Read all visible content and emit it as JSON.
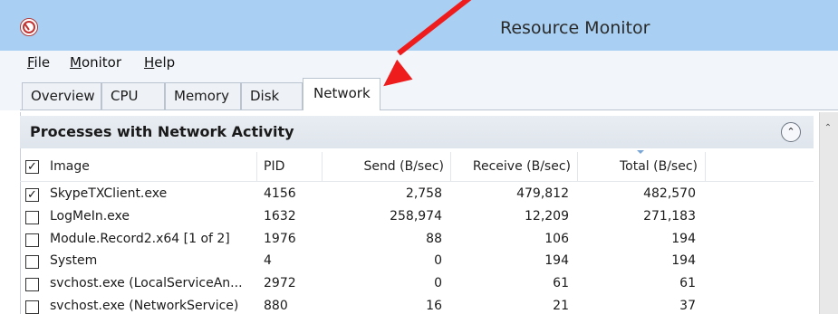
{
  "window": {
    "title": "Resource Monitor",
    "app_icon": "resource-monitor-icon"
  },
  "menu": [
    {
      "label": "F",
      "rest": "ile"
    },
    {
      "label": "M",
      "rest": "onitor"
    },
    {
      "label": "H",
      "rest": "elp"
    }
  ],
  "tabs": [
    {
      "label": "Overview"
    },
    {
      "label": "CPU"
    },
    {
      "label": "Memory"
    },
    {
      "label": "Disk"
    },
    {
      "label": "Network",
      "active": true
    }
  ],
  "section": {
    "title": "Processes with Network Activity",
    "collapse_icon": "chevron-up-icon"
  },
  "table": {
    "headers": [
      "Image",
      "PID",
      "Send (B/sec)",
      "Receive (B/sec)",
      "Total (B/sec)"
    ],
    "sorted_column": "Total (B/sec)",
    "header_checked": true,
    "rows": [
      {
        "checked": true,
        "image": "SkypeTXClient.exe",
        "pid": "4156",
        "send": "2,758",
        "receive": "479,812",
        "total": "482,570"
      },
      {
        "checked": false,
        "image": "LogMeIn.exe",
        "pid": "1632",
        "send": "258,974",
        "receive": "12,209",
        "total": "271,183"
      },
      {
        "checked": false,
        "image": "Module.Record2.x64 [1 of 2]",
        "pid": "1976",
        "send": "88",
        "receive": "106",
        "total": "194"
      },
      {
        "checked": false,
        "image": "System",
        "pid": "4",
        "send": "0",
        "receive": "194",
        "total": "194"
      },
      {
        "checked": false,
        "image": "svchost.exe (LocalServiceAn...",
        "pid": "2972",
        "send": "0",
        "receive": "61",
        "total": "61"
      },
      {
        "checked": false,
        "image": "svchost.exe (NetworkService)",
        "pid": "880",
        "send": "16",
        "receive": "21",
        "total": "37"
      }
    ]
  },
  "annotation": {
    "type": "red-arrow",
    "color": "#ee1c1c",
    "points_to": "Network"
  }
}
